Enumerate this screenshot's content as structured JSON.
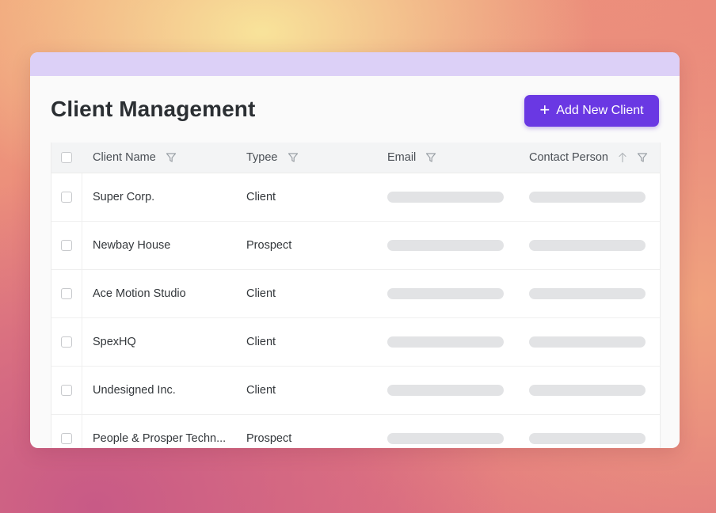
{
  "page": {
    "title": "Client Management",
    "add_button_label": "Add New Client",
    "accent_color": "#6a38e3",
    "titlebar_color": "#dcd0f7"
  },
  "table": {
    "columns": [
      {
        "label": "Client Name",
        "filterable": true
      },
      {
        "label": "Typee",
        "filterable": true
      },
      {
        "label": "Email",
        "filterable": true
      },
      {
        "label": "Contact Person",
        "filterable": true,
        "sortable": true
      }
    ],
    "rows": [
      {
        "name": "Super Corp.",
        "type": "Client"
      },
      {
        "name": "Newbay House",
        "type": "Prospect"
      },
      {
        "name": "Ace Motion Studio",
        "type": "Client"
      },
      {
        "name": "SpexHQ",
        "type": "Client"
      },
      {
        "name": "Undesigned Inc.",
        "type": "Client"
      },
      {
        "name": "People & Prosper Techn...",
        "type": "Prospect"
      }
    ]
  },
  "icons": {
    "add": "plus-icon",
    "filter": "filter-icon",
    "sort": "arrow-up-icon"
  }
}
